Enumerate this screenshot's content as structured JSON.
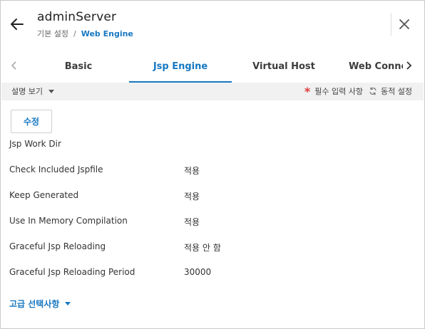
{
  "header": {
    "title": "adminServer",
    "breadcrumb": {
      "parent": "기본 설정",
      "separator": "/",
      "current": "Web Engine"
    }
  },
  "tabs": [
    {
      "label": "Basic",
      "active": false
    },
    {
      "label": "Jsp Engine",
      "active": true
    },
    {
      "label": "Virtual Host",
      "active": false
    },
    {
      "label": "Web Conne",
      "active": false
    }
  ],
  "toolbar": {
    "description_toggle": "설명 보기",
    "required_legend": "필수 입력 사항",
    "dynamic_legend": "동적 설정",
    "required_symbol": "*"
  },
  "actions": {
    "edit_label": "수정"
  },
  "fields": [
    {
      "label": "Jsp Work Dir",
      "value": ""
    },
    {
      "label": "Check Included Jspfile",
      "value": "적용"
    },
    {
      "label": "Keep Generated",
      "value": "적용"
    },
    {
      "label": "Use In Memory Compilation",
      "value": "적용"
    },
    {
      "label": "Graceful Jsp Reloading",
      "value": "적용 안 함"
    },
    {
      "label": "Graceful Jsp Reloading Period",
      "value": "30000"
    }
  ],
  "advanced_label": "고급 선택사항",
  "colors": {
    "accent": "#1878c1",
    "required": "#e03a3a",
    "toolbar_bg": "#f1f1f1"
  },
  "icons": {
    "back": "arrow-left-icon",
    "close": "close-icon",
    "prev": "chevron-left-icon",
    "next": "chevron-right-icon",
    "dynamic": "refresh-icon"
  }
}
